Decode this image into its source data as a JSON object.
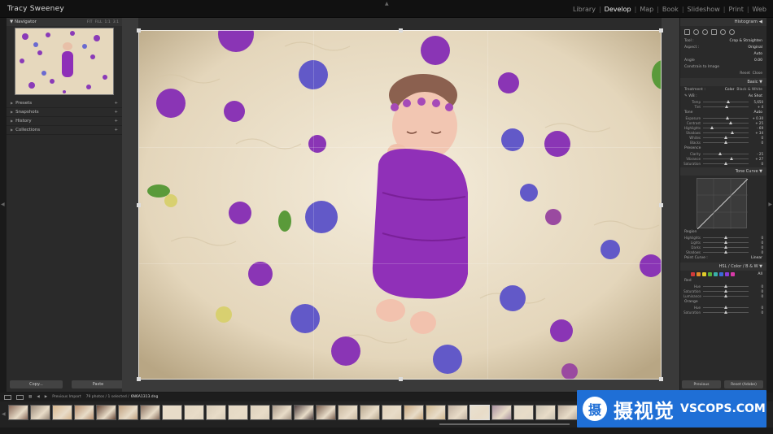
{
  "app": {
    "title": "Tracy Sweeney"
  },
  "modules": [
    {
      "label": "Library",
      "active": false
    },
    {
      "label": "Develop",
      "active": true
    },
    {
      "label": "Map",
      "active": false
    },
    {
      "label": "Book",
      "active": false
    },
    {
      "label": "Slideshow",
      "active": false
    },
    {
      "label": "Print",
      "active": false
    },
    {
      "label": "Web",
      "active": false
    }
  ],
  "left_panel": {
    "navigator_label": "Navigator",
    "nav_options": [
      "FIT",
      "FILL",
      "1:1",
      "3:1"
    ],
    "sections": [
      {
        "label": "Presets"
      },
      {
        "label": "Snapshots"
      },
      {
        "label": "History"
      },
      {
        "label": "Collections"
      }
    ],
    "copy_label": "Copy...",
    "paste_label": "Paste"
  },
  "right_panel": {
    "histogram_label": "Histogram",
    "tool_label": "Tool :",
    "tool_value": "Crop & Straighten",
    "aspect_label": "Aspect :",
    "aspect_value": "Original",
    "auto_label": "Auto",
    "angle_label": "Angle",
    "angle_value": "0.00",
    "constrain_label": "Constrain to Image",
    "reset_label": "Reset",
    "close_label": "Close",
    "basic_label": "Basic",
    "treatment_label": "Treatment :",
    "treatment_color": "Color",
    "treatment_bw": "Black & White",
    "wb_label": "WB :",
    "wb_value": "As Shot",
    "tone_label": "Tone",
    "tone_auto": "Auto",
    "presence_label": "Presence",
    "basic_sliders": [
      {
        "label": "Temp",
        "value": "5,650",
        "pos": 0.55
      },
      {
        "label": "Tint",
        "value": "+ 4",
        "pos": 0.52
      },
      {
        "label": "Exposure",
        "value": "+ 0.30",
        "pos": 0.54
      },
      {
        "label": "Contrast",
        "value": "+ 25",
        "pos": 0.6
      },
      {
        "label": "Highlights",
        "value": "- 69",
        "pos": 0.2
      },
      {
        "label": "Shadows",
        "value": "+ 34",
        "pos": 0.65
      },
      {
        "label": "Whites",
        "value": "0",
        "pos": 0.5
      },
      {
        "label": "Blacks",
        "value": "0",
        "pos": 0.5
      },
      {
        "label": "Clarity",
        "value": "- 25",
        "pos": 0.38
      },
      {
        "label": "Vibrance",
        "value": "+ 27",
        "pos": 0.62
      },
      {
        "label": "Saturation",
        "value": "0",
        "pos": 0.5
      }
    ],
    "tone_curve_label": "Tone Curve",
    "region_label": "Region",
    "region_sliders": [
      {
        "label": "Highlights",
        "value": "0",
        "pos": 0.5
      },
      {
        "label": "Lights",
        "value": "0",
        "pos": 0.5
      },
      {
        "label": "Darks",
        "value": "0",
        "pos": 0.5
      },
      {
        "label": "Shadows",
        "value": "0",
        "pos": 0.5
      }
    ],
    "point_curve_label": "Point Curve :",
    "point_curve_value": "Linear",
    "hsl_label": "HSL / Color / B & W",
    "all_label": "All",
    "red_label": "Red",
    "orange_label": "Orange",
    "hsl_sliders_red": [
      {
        "label": "Hue",
        "value": "0",
        "pos": 0.5
      },
      {
        "label": "Saturation",
        "value": "0",
        "pos": 0.5
      },
      {
        "label": "Luminance",
        "value": "0",
        "pos": 0.5
      }
    ],
    "hsl_sliders_orange": [
      {
        "label": "Hue",
        "value": "0",
        "pos": 0.5
      },
      {
        "label": "Saturation",
        "value": "0",
        "pos": 0.5
      }
    ],
    "hsl_colors": [
      "#d23a3a",
      "#e08a2a",
      "#e0cc2a",
      "#5ab03a",
      "#3ab0a8",
      "#3a6ad8",
      "#8a3ad8",
      "#d83aa8"
    ],
    "previous_label": "Previous",
    "reset_adobe_label": "Reset (Adobe)"
  },
  "strip_toolbar": {
    "source": "Previous Import",
    "count": "79 photos / 1 selected /",
    "filename": "6N6A1313.dng"
  },
  "filmstrip": {
    "thumbs": [
      "#8a6a5a",
      "#9a8a7a",
      "#d8b890",
      "#b89070",
      "#6a4a3a",
      "#c0a080",
      "#8a7060",
      "#e8dcc8",
      "#e0d4c0",
      "#d8ccb8",
      "#e4d8c4",
      "#dcd0bc",
      "#a89888",
      "#504040",
      "#7a6050",
      "#c8b8a0",
      "#b8a890",
      "#e0d0b8",
      "#c8a880",
      "#d0b890",
      "#c0b0a0",
      "#e8e0d0",
      "#a890a0",
      "#e0d8c8",
      "#c8c0b0",
      "#b8a898"
    ],
    "active_index": 21
  },
  "watermark": {
    "mark": "摄",
    "chinese": "摄视觉",
    "english": "VSCOPS.COM"
  },
  "colors": {
    "accent_watermark": "#1f6fd6",
    "background": "#1a1a1a",
    "panel": "#2a2a2a"
  }
}
